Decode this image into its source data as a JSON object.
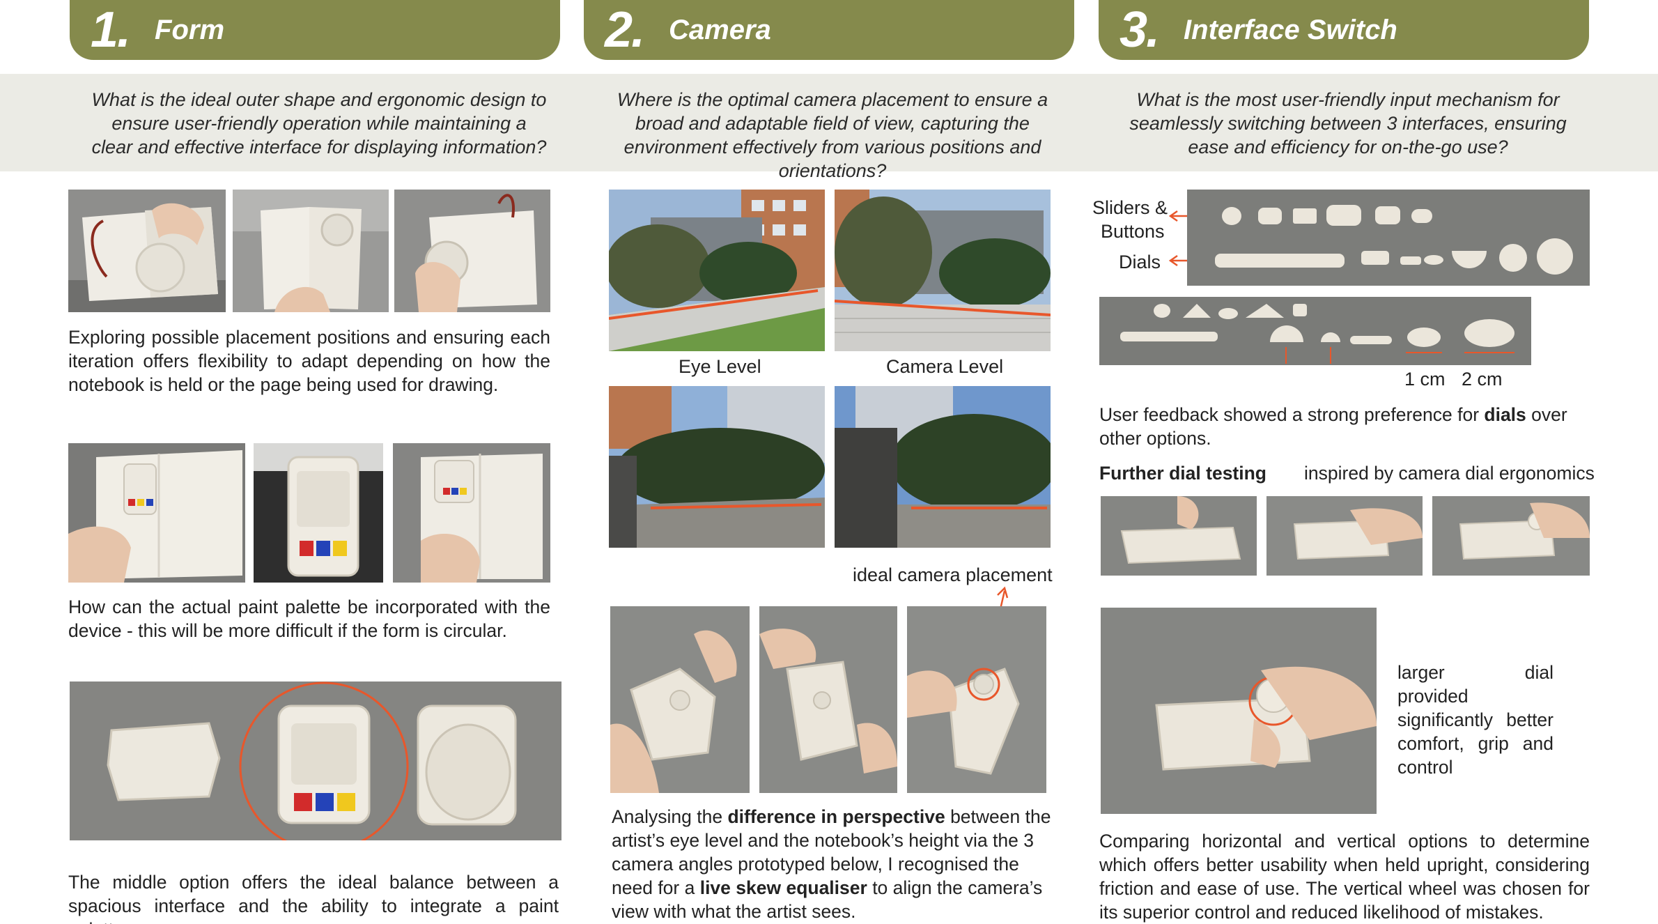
{
  "sections": [
    {
      "number": "1.",
      "title": "Form",
      "question": "What is the ideal outer shape and ergonomic design to ensure user-friendly operation while maintaining a clear and effective interface for displaying information?"
    },
    {
      "number": "2.",
      "title": "Camera",
      "question": "Where is the optimal camera placement to ensure a broad and adaptable field of view, capturing the environment effectively from various positions and orientations?"
    },
    {
      "number": "3.",
      "title": "Interface Switch",
      "question": "What is the most user-friendly input mechanism for seamlessly switching between 3 interfaces, ensuring ease and efficiency for on-the-go use?"
    }
  ],
  "form": {
    "text1": "Exploring possible placement positions and ensuring each iteration offers flexibility to adapt depending on how the notebook is held or the page being used for drawing.",
    "text2": "How can the actual paint palette be incorporated with the device - this will be more difficult if the form is circular.",
    "text3": "The middle option offers the ideal balance between a spacious interface and the ability to integrate a paint palette."
  },
  "camera": {
    "label_eye": "Eye Level",
    "label_camera": "Camera Level",
    "label_ideal": "ideal camera placement",
    "text_a": "Analysing the ",
    "text_b": "difference in perspective",
    "text_c": " between the artist’s eye level and the notebook’s height via the 3 camera angles prototyped below, I recognised the need for a ",
    "text_d": "live skew equaliser",
    "text_e": " to align the camera’s view with what the artist sees."
  },
  "interface": {
    "label_sliders": "Sliders &",
    "label_buttons": "Buttons",
    "label_dials": "Dials",
    "label_1cm": "1 cm",
    "label_2cm": "2 cm",
    "feedback_a": "User feedback showed a strong preference for ",
    "feedback_b": "dials",
    "feedback_c": " over other options.",
    "further_title": "Further dial testing",
    "further_sub": "inspired by camera dial ergonomics",
    "larger_dial": "larger dial provided significantly better comfort, grip and control",
    "comparing": "Comparing horizontal and vertical options to determine which offers better usability when held upright, considering friction and ease of use. The vertical wheel was chosen for its superior control and reduced likelihood of mistakes."
  },
  "colors": {
    "accent": "#858a4c",
    "band": "#ebebe5",
    "highlight": "#e8572b"
  }
}
